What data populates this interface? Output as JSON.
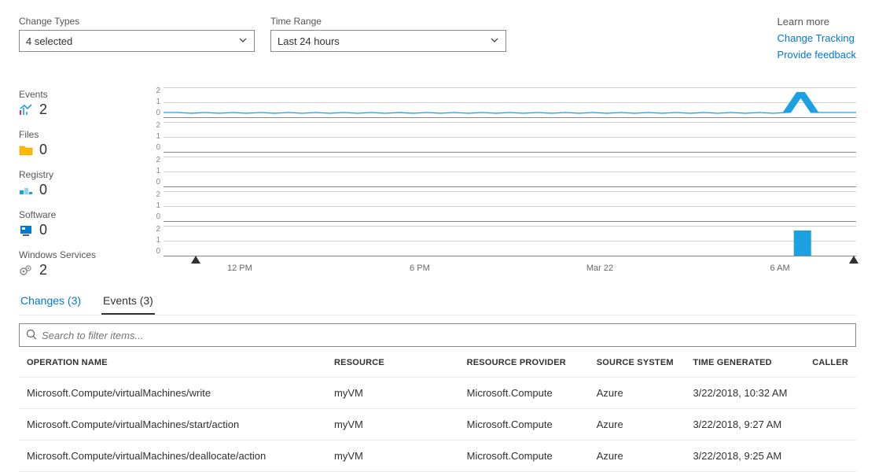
{
  "filters": {
    "change_types": {
      "label": "Change Types",
      "value": "4 selected"
    },
    "time_range": {
      "label": "Time Range",
      "value": "Last 24 hours"
    }
  },
  "learn_more": {
    "heading": "Learn more",
    "links": [
      "Change Tracking",
      "Provide feedback"
    ]
  },
  "categories": [
    {
      "label": "Events",
      "count": "2",
      "icon": "events"
    },
    {
      "label": "Files",
      "count": "0",
      "icon": "files"
    },
    {
      "label": "Registry",
      "count": "0",
      "icon": "registry"
    },
    {
      "label": "Software",
      "count": "0",
      "icon": "software"
    },
    {
      "label": "Windows Services",
      "count": "2",
      "icon": "services"
    }
  ],
  "chart_data": [
    {
      "type": "line",
      "series_name": "Events",
      "ylim": [
        0,
        2
      ],
      "yticks": [
        "2",
        "1",
        "0"
      ],
      "x_categories": [
        "12 PM",
        "6 PM",
        "Mar 22",
        "6 AM"
      ],
      "peak": {
        "x_frac": 0.92,
        "value": 2
      }
    },
    {
      "type": "line",
      "series_name": "Files",
      "ylim": [
        0,
        2
      ],
      "yticks": [
        "2",
        "1",
        "0"
      ],
      "flat_value": 0
    },
    {
      "type": "line",
      "series_name": "Registry",
      "ylim": [
        0,
        2
      ],
      "yticks": [
        "2",
        "1",
        "0"
      ],
      "flat_value": 0
    },
    {
      "type": "line",
      "series_name": "Software",
      "ylim": [
        0,
        2
      ],
      "yticks": [
        "2",
        "1",
        "0"
      ],
      "flat_value": 0
    },
    {
      "type": "bar",
      "series_name": "Windows Services",
      "ylim": [
        0,
        2
      ],
      "yticks": [
        "2",
        "1",
        "0"
      ],
      "bars": [
        {
          "x_frac": 0.92,
          "value": 2
        }
      ]
    }
  ],
  "x_axis": {
    "labels": [
      "12 PM",
      "6 PM",
      "Mar 22",
      "6 AM"
    ],
    "positions": [
      0.11,
      0.37,
      0.63,
      0.89
    ],
    "marker_left": 0.05,
    "marker_right": 1.0
  },
  "tabs": [
    {
      "label": "Changes (3)",
      "active": false
    },
    {
      "label": "Events (3)",
      "active": true
    }
  ],
  "search": {
    "placeholder": "Search to filter items..."
  },
  "table": {
    "columns": [
      "OPERATION NAME",
      "RESOURCE",
      "RESOURCE PROVIDER",
      "SOURCE SYSTEM",
      "TIME GENERATED",
      "CALLER"
    ],
    "rows": [
      {
        "op": "Microsoft.Compute/virtualMachines/write",
        "res": "myVM",
        "prov": "Microsoft.Compute",
        "src": "Azure",
        "time": "3/22/2018, 10:32 AM",
        "caller": ""
      },
      {
        "op": "Microsoft.Compute/virtualMachines/start/action",
        "res": "myVM",
        "prov": "Microsoft.Compute",
        "src": "Azure",
        "time": "3/22/2018, 9:27 AM",
        "caller": ""
      },
      {
        "op": "Microsoft.Compute/virtualMachines/deallocate/action",
        "res": "myVM",
        "prov": "Microsoft.Compute",
        "src": "Azure",
        "time": "3/22/2018, 9:25 AM",
        "caller": ""
      }
    ]
  },
  "colors": {
    "accent": "#0078d4",
    "chart_line": "#1ba1e2",
    "chart_fill": "#1ba1e2"
  }
}
